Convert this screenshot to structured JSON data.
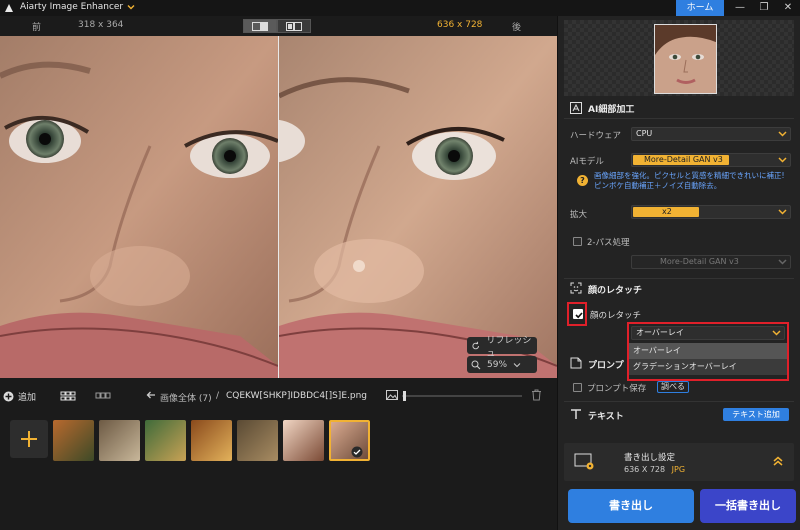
{
  "app": {
    "title": "Aiarty Image Enhancer",
    "home_label": "ホーム"
  },
  "window": {
    "minimize": "—",
    "restore": "❐",
    "close": "✕"
  },
  "compare": {
    "before_label": "前",
    "before_size": "318 x 364",
    "after_size": "636 x 728",
    "after_label": "後"
  },
  "viewer": {
    "refresh_label": "リフレッシュ",
    "zoom_label": "59%"
  },
  "toolbar": {
    "add_label": "追加",
    "breadcrumb_all": "画像全体 (7)",
    "separator": "/",
    "file_name": "CQEKW[SHKP]IDBDC4[]S]E.png"
  },
  "thumbnails": [
    {
      "name": "tiger",
      "c1": "#b8692e",
      "c2": "#3d4a27"
    },
    {
      "name": "bird",
      "c1": "#6d5a44",
      "c2": "#c8b79a"
    },
    {
      "name": "forest",
      "c1": "#3f6b3a",
      "c2": "#c9a255"
    },
    {
      "name": "burger",
      "c1": "#8a4a1c",
      "c2": "#e3b25b"
    },
    {
      "name": "owl",
      "c1": "#5a4a34",
      "c2": "#a88c62"
    },
    {
      "name": "portrait",
      "c1": "#f1d6c4",
      "c2": "#7b4a35"
    },
    {
      "name": "face-selected",
      "c1": "#d9aa90",
      "c2": "#6e4c3a"
    }
  ],
  "panel": {
    "section_detail_title": "AI細部加工",
    "hardware_label": "ハードウェア",
    "hardware_value": "CPU",
    "model_label": "AIモデル",
    "model_value": "More-Detail GAN  v3",
    "model_desc_line1": "画像細部を強化。ピクセルと質感を精細できれいに補正!",
    "model_desc_line2": "ピンボケ自動補正＋ノイズ自動除去。",
    "scale_label": "拡大",
    "scale_value": "x2",
    "two_pass_label": "2-パス処理",
    "two_pass_value": "More-Detail GAN  v3",
    "section_face_title": "顔のレタッチ",
    "face_checkbox_label": "顔のレタッチ",
    "face_mode_value": "オーバーレイ",
    "face_mode_options": [
      "オーバーレイ",
      "グラデーションオーバーレイ"
    ],
    "section_prompt_title": "プロンプ",
    "prompt_save_label": "プロンプト保存",
    "prompt_check_label": "調べる",
    "section_text_title": "テキスト",
    "add_text_label": "テキスト追加",
    "export_title": "書き出し設定",
    "export_size": "636 X 728",
    "export_format": "JPG",
    "export_button": "書き出し",
    "batch_export_button": "一括書き出し"
  },
  "colors": {
    "accent_blue": "#2f7fe0",
    "accent_yellow": "#f1b233",
    "highlight_red": "#e0202a"
  }
}
